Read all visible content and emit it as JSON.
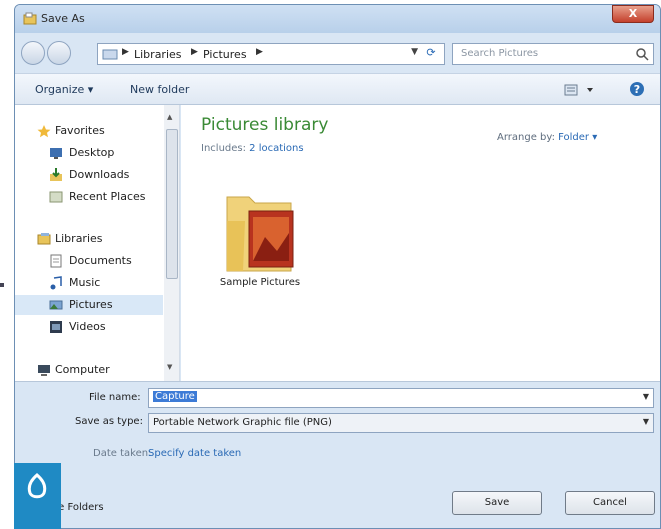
{
  "window": {
    "title": "Save As",
    "close_label": "X"
  },
  "nav": {
    "breadcrumbs": [
      "Libraries",
      "Pictures"
    ],
    "search_placeholder": "Search Pictures"
  },
  "toolbar": {
    "organize": "Organize ▾",
    "new_folder": "New folder"
  },
  "sidebar": {
    "items": [
      {
        "label": "Favorites",
        "icon": "star-icon"
      },
      {
        "label": "Desktop",
        "icon": "desktop-icon"
      },
      {
        "label": "Downloads",
        "icon": "downloads-icon"
      },
      {
        "label": "Recent Places",
        "icon": "recent-places-icon"
      },
      {
        "label": "Libraries",
        "icon": "libraries-icon"
      },
      {
        "label": "Documents",
        "icon": "documents-icon"
      },
      {
        "label": "Music",
        "icon": "music-icon"
      },
      {
        "label": "Pictures",
        "icon": "pictures-icon"
      },
      {
        "label": "Videos",
        "icon": "videos-icon"
      },
      {
        "label": "Computer",
        "icon": "computer-icon"
      }
    ]
  },
  "content": {
    "library_title": "Pictures library",
    "includes_label": "Includes:",
    "includes_link": "2 locations",
    "arrange_label": "Arrange by:",
    "arrange_value": "Folder",
    "folders": [
      {
        "label": "Sample Pictures"
      }
    ]
  },
  "form": {
    "file_name_label": "File name:",
    "file_name_value": "Capture",
    "save_type_label": "Save as type:",
    "save_type_value": "Portable Network Graphic file (PNG)",
    "date_taken_label": "Date taken:",
    "date_taken_link": "Specify date taken"
  },
  "footer": {
    "hide_folders": "ide Folders",
    "save_button": "Save",
    "cancel_button": "Cancel"
  },
  "colors": {
    "accent": "#2a6ab5",
    "library_title": "#3a8a35",
    "badge": "#1f8ac4"
  }
}
